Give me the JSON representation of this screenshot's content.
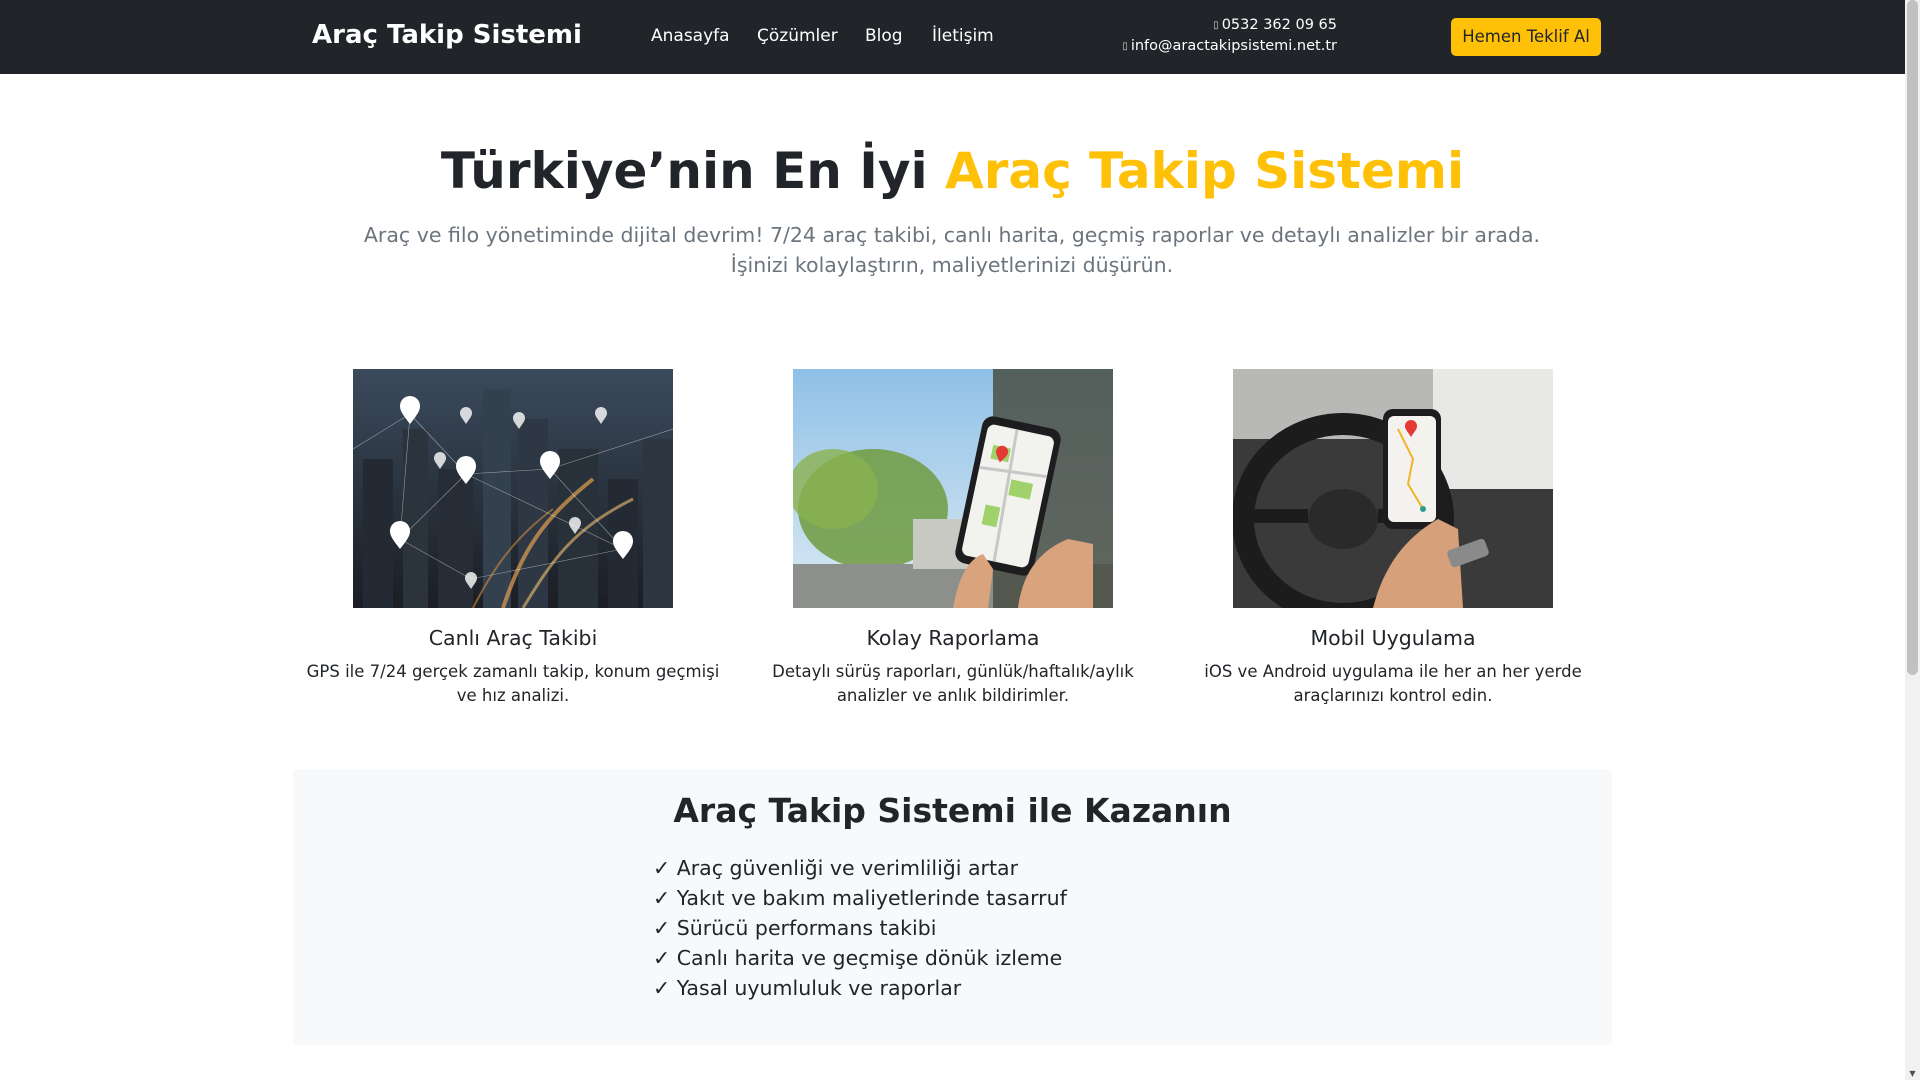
{
  "navbar": {
    "brand": "Araç Takip Sistemi",
    "links": [
      "Anasayfa",
      "Çözümler",
      "Blog",
      "İletişim"
    ],
    "phone": "0532 362 09 65",
    "email": "info@aractakipsistemi.net.tr",
    "phone_icon": "phone-icon",
    "email_icon": "envelope-icon",
    "cta": "Hemen Teklif Al"
  },
  "hero": {
    "title_part1": "Türkiye’nin En İyi",
    "title_part2": "Araç Takip Sistemi",
    "subtitle": "Araç ve filo yönetiminde dijital devrim! 7/24 araç takibi, canlı harita, geçmiş raporlar ve detaylı analizler bir arada. İşinizi kolaylaştırın, maliyetlerinizi düşürün."
  },
  "features": [
    {
      "title": "Canlı Araç Takibi",
      "text": "GPS ile 7/24 gerçek zamanlı takip, konum geçmişi ve hız analizi."
    },
    {
      "title": "Kolay Raporlama",
      "text": "Detaylı sürüş raporları, günlük/haftalık/aylık analizler ve anlık bildirimler."
    },
    {
      "title": "Mobil Uygulama",
      "text": "iOS ve Android uygulama ile her an her yerde araçlarınızı kontrol edin."
    }
  ],
  "benefits": {
    "title": "Araç Takip Sistemi ile Kazanın",
    "check": "✓",
    "items": [
      "Araç güvenliği ve verimliliği artar",
      "Yakıt ve bakım maliyetlerinde tasarruf",
      "Sürücü performans takibi",
      "Canlı harita ve geçmişe dönük izleme",
      "Yasal uyumluluk ve raporlar"
    ]
  },
  "colors": {
    "navbar_bg": "#212529",
    "accent": "#ffc107",
    "muted": "#6c757d",
    "section_bg": "#f8f9fa"
  }
}
